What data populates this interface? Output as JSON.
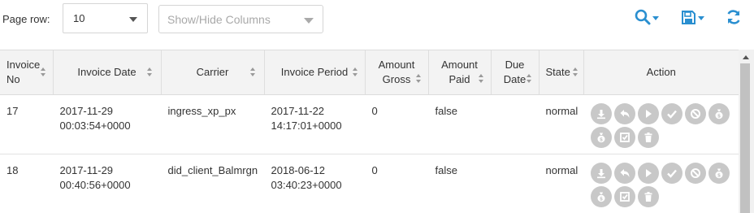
{
  "toolbar": {
    "page_row_label": "Page row:",
    "page_row_value": "10",
    "columns_placeholder": "Show/Hide Columns",
    "accent_color": "#2a8fd0"
  },
  "table": {
    "headers": {
      "invoice_no": "Invoice No",
      "invoice_date": "Invoice Date",
      "carrier": "Carrier",
      "invoice_period": "Invoice Period",
      "amount_gross": "Amount Gross",
      "amount_paid": "Amount Paid",
      "due_date": "Due Date",
      "state": "State",
      "action": "Action"
    },
    "rows": [
      {
        "invoice_no": "17",
        "invoice_date_1": "2017-11-29",
        "invoice_date_2": "00:03:54+0000",
        "carrier": "ingress_xp_px",
        "period_1": "2017-11-22",
        "period_2": "14:17:01+0000",
        "amount_gross": "0",
        "amount_paid": "false",
        "due_date": "",
        "state": "normal"
      },
      {
        "invoice_no": "18",
        "invoice_date_1": "2017-11-29",
        "invoice_date_2": "00:40:56+0000",
        "carrier": "did_client_Balmrgn",
        "period_1": "2018-06-12",
        "period_2": "03:40:23+0000",
        "amount_gross": "0",
        "amount_paid": "false",
        "due_date": "",
        "state": "normal"
      }
    ],
    "action_icons": [
      "download-icon",
      "undo-icon",
      "play-icon",
      "check-icon",
      "ban-icon",
      "money-bag-icon",
      "money-bag-icon",
      "checkbox-icon",
      "trash-icon"
    ]
  }
}
